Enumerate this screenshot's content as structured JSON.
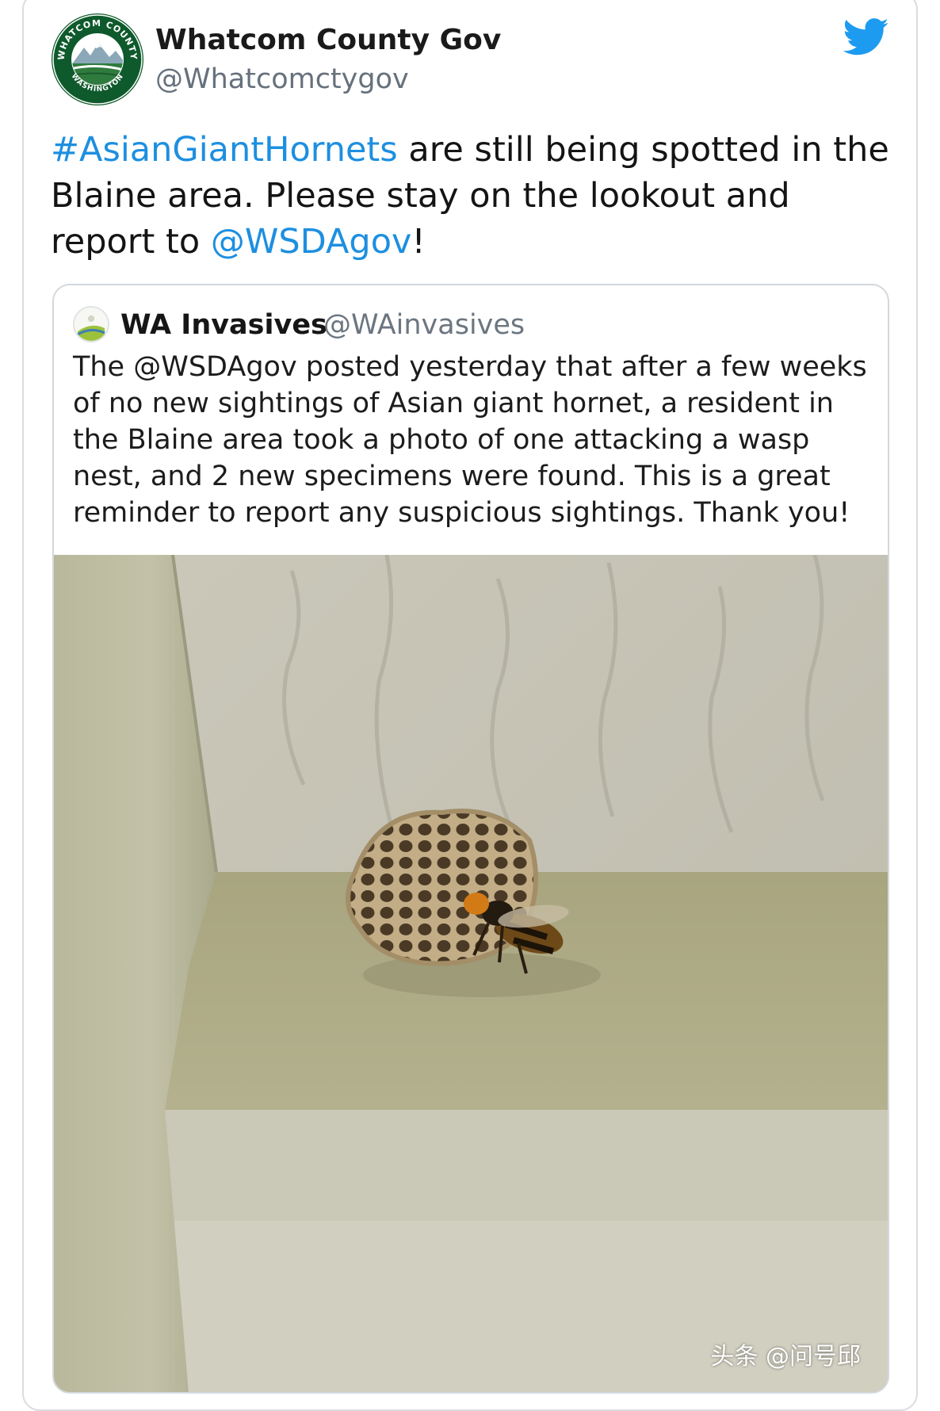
{
  "tweet": {
    "author": {
      "name": "Whatcom County Gov",
      "handle": "@Whatcomctygov",
      "avatar_text_top": "WHATCOM COUNTY",
      "avatar_text_bottom": "WASHINGTON"
    },
    "text": {
      "hashtag": "#AsianGiantHornets",
      "part1": " are still being spotted in the Blaine area. Please stay on the lookout and report to ",
      "mention": "@WSDAgov",
      "part2": "!"
    },
    "icon": "twitter-bird-icon"
  },
  "quoted_tweet": {
    "name": "WA Invasives",
    "handle": "@WAinvasives",
    "text": "The @WSDAgov posted yesterday that after a few weeks of no new sightings of Asian giant hornet, a resident in the Blaine area took a photo of one attacking a wasp nest, and 2 new specimens were found. This is a great reminder to report any suspicious sightings. Thank you!",
    "media": "photo-hornet-on-wasp-nest"
  },
  "watermark": "头条 @问号邱",
  "colors": {
    "link": "#1d8fe0",
    "twitter_blue": "#1d9bf0",
    "border": "#d9dde1",
    "handle_gray": "#66717c"
  }
}
